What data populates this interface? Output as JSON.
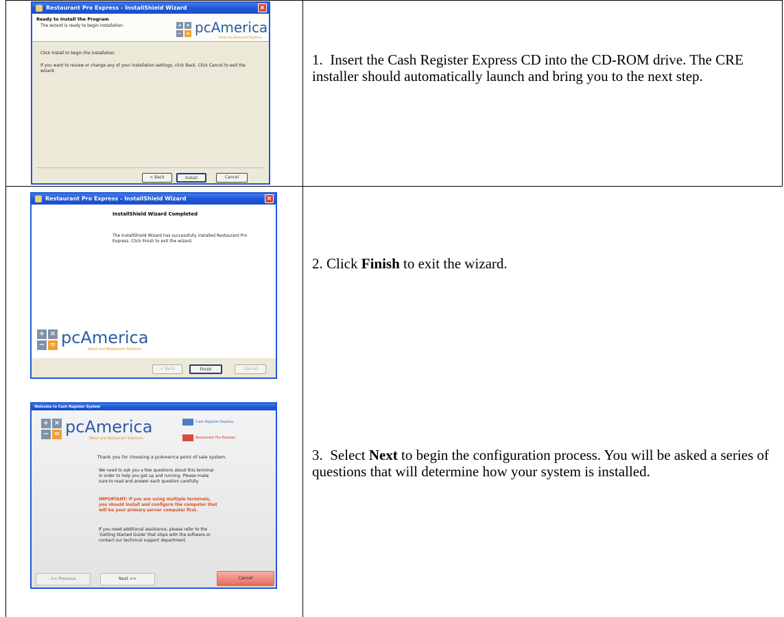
{
  "steps": [
    {
      "number": "1.",
      "text": "Insert the Cash Register Express CD into the CD-ROM drive.  The CRE installer should automatically launch and bring you to the next step."
    },
    {
      "number": "2.",
      "pre": "Click ",
      "bold": "Finish",
      "post": " to exit the wizard."
    },
    {
      "number": "3.",
      "pre": "Select ",
      "bold": "Next",
      "post": " to begin the configuration process.  You will be asked a series of questions that will determine how your system is installed."
    }
  ],
  "shot1": {
    "title": "Restaurant Pro Express - InstallShield Wizard",
    "heading": "Ready to Install the Program",
    "subheading": "The wizard is ready to begin installation.",
    "line1": "Click Install to begin the installation.",
    "line2": "If you want to review or change any of your installation settings, click Back. Click Cancel to exit the wizard.",
    "logo_text": "pcAmerica",
    "logo_tag": "Retail and Restaurant Solutions",
    "back": "< Back",
    "install": "Install",
    "cancel": "Cancel"
  },
  "shot2": {
    "title": "Restaurant Pro Express - InstallShield Wizard",
    "heading": "InstallShield Wizard Completed",
    "body": "The InstallShield Wizard has successfully installed Restaurant Pro Express. Click Finish to exit the wizard.",
    "logo_text": "pcAmerica",
    "logo_tag": "Retail and Restaurant Solutions",
    "back": "< Back",
    "finish": "Finish",
    "cancel": "Cancel"
  },
  "shot3": {
    "title": "Welcome to Cash Register System",
    "logo_text": "pcAmerica",
    "logo_tag": "Retail and Restaurant Solutions",
    "product1": "Cash Register Express",
    "product2": "Restaurant Pro Express",
    "thanks": "Thank you for choosing a pcAmerica point of sale system.",
    "para1": "We need to ask you a few questions about this terminal in order to help you get up and running. Please make sure to read and answer each question carefully.",
    "important": "IMPORTANT: If you are using multiple terminals, you should install and configure the computer that will be your primary server computer first.",
    "para2": "If you need additional assistance, please refer to the 'Getting Started Guide' that ships with the software or contact our technical support department.",
    "previous": "<< Previous",
    "next": "Next >>",
    "cancel": "Cancel"
  }
}
